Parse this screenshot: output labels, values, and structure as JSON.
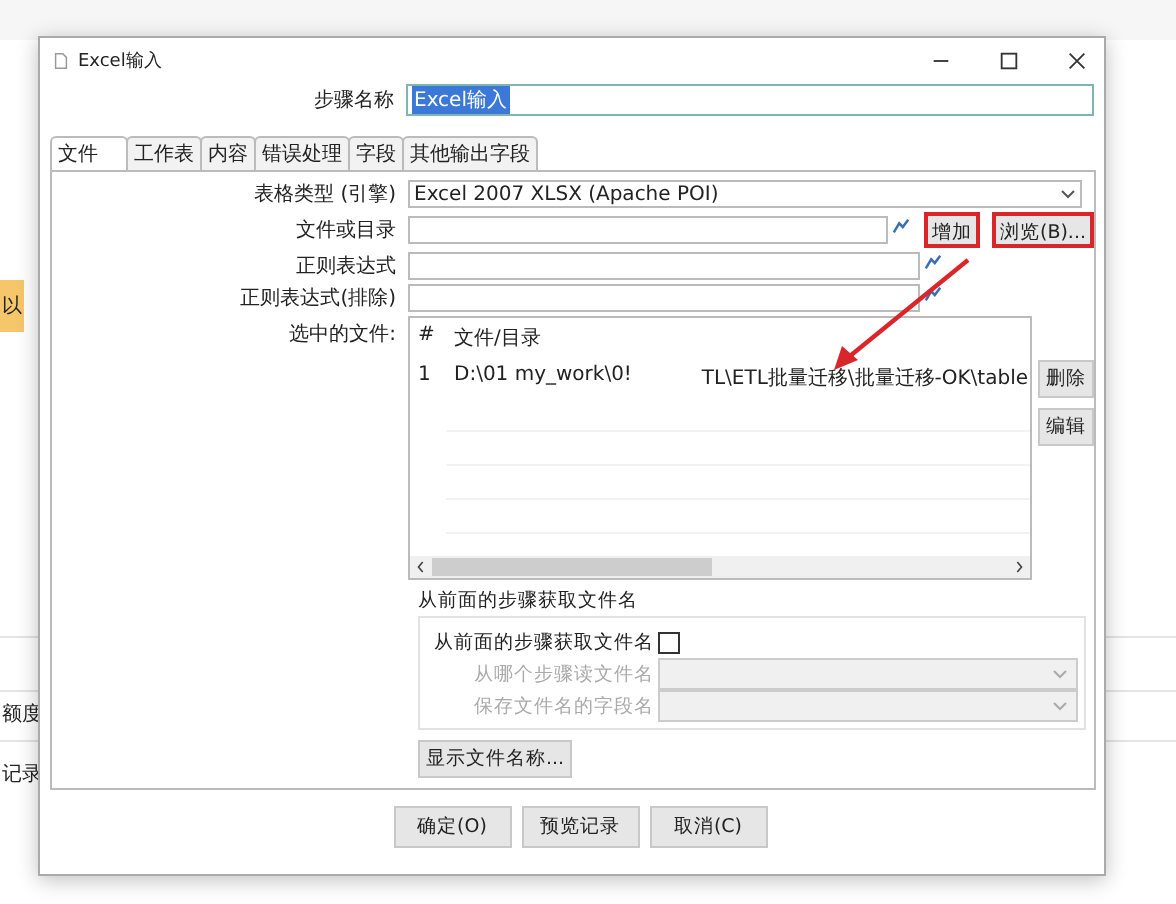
{
  "background_app": {
    "texts": [
      {
        "text": "以",
        "kind": "tag"
      },
      {
        "text": "额度",
        "kind": "plain"
      },
      {
        "text": "记录",
        "kind": "plain"
      }
    ]
  },
  "window": {
    "title": "Excel输入"
  },
  "step_name": {
    "label": "步骤名称",
    "value": "Excel输入",
    "highlighted": true
  },
  "tabs": [
    {
      "label": "文件",
      "selected": true
    },
    {
      "label": "工作表",
      "selected": false
    },
    {
      "label": "内容",
      "selected": false
    },
    {
      "label": "错误处理",
      "selected": false
    },
    {
      "label": "字段",
      "selected": false
    },
    {
      "label": "其他输出字段",
      "selected": false
    }
  ],
  "fields": [
    {
      "label": "表格类型 (引擎)",
      "kind": "dropdown",
      "value": "Excel 2007 XLSX (Apache POI)"
    },
    {
      "label": "文件或目录",
      "kind": "file",
      "buttons": [
        {
          "label": "增加",
          "highlighted": true
        },
        {
          "label": "浏览(B)...",
          "highlighted": true
        }
      ]
    },
    {
      "label": "正则表达式",
      "kind": "text"
    },
    {
      "label": "正则表达式(排除)",
      "kind": "text"
    }
  ],
  "selected_files": {
    "label": "选中的文件:",
    "columns": [
      "#",
      "文件/目录"
    ],
    "rows": [
      {
        "cells": [
          "1",
          "D:\\01 my_work\\0!",
          "TL\\ETL批量迁移\\批量迁移-OK\\table"
        ]
      }
    ],
    "buttons": [
      "删除",
      "编辑"
    ]
  },
  "previous_step_group": {
    "title": "从前面的步骤获取文件名",
    "checkbox": {
      "label": "从前面的步骤获取文件名",
      "checked": false
    },
    "fields": [
      {
        "label": "从哪个步骤读文件名",
        "disabled": true
      },
      {
        "label": "保存文件名的字段名",
        "disabled": true
      }
    ]
  },
  "show_filenames_button": "显示文件名称...",
  "buttons": [
    "确定(O)",
    "预览记录",
    "取消(C)"
  ]
}
